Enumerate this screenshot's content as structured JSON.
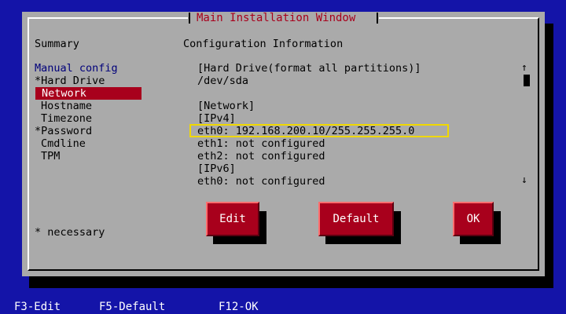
{
  "window": {
    "title": "Main Installation Window"
  },
  "left_panel": {
    "heading": "Summary",
    "items": [
      {
        "label": "Manual config"
      },
      {
        "label": "*Hard Drive"
      },
      {
        "label": "Network"
      },
      {
        "label": "Hostname"
      },
      {
        "label": "Timezone"
      },
      {
        "label": "*Password"
      },
      {
        "label": "Cmdline"
      },
      {
        "label": "TPM"
      }
    ],
    "note": "* necessary"
  },
  "right_panel": {
    "heading": "Configuration Information",
    "lines": [
      "[Hard Drive(format all partitions)]",
      "/dev/sda",
      "",
      "[Network]",
      "[IPv4]",
      "eth0: 192.168.200.10/255.255.255.0",
      "eth1: not configured",
      "eth2: not configured",
      "[IPv6]",
      "eth0: not configured"
    ],
    "scroll_up": "↑",
    "scroll_down": "↓"
  },
  "buttons": {
    "edit": "Edit",
    "default": "Default",
    "ok": "OK"
  },
  "footer": {
    "f3": "F3-Edit",
    "f5": "F5-Default",
    "f12": "F12-OK"
  },
  "colors": {
    "background": "#1414a8",
    "window": "#aaaaaa",
    "accent": "#a8001c",
    "highlight": "#f0d800",
    "link": "#00007a"
  }
}
